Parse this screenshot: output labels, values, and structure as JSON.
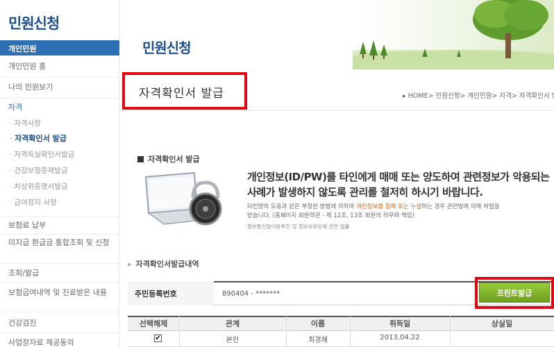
{
  "sidebar": {
    "title": "민원신청",
    "section": "개인민원",
    "items": [
      {
        "label": "개인민원 홈"
      },
      {
        "label": "나의 민원보기"
      },
      {
        "label": "자격"
      }
    ],
    "sub_items": [
      {
        "label": "자격사항",
        "active": false
      },
      {
        "label": "자격확인서 발급",
        "active": true
      },
      {
        "label": "자격득실확인서발급",
        "active": false
      },
      {
        "label": "건강보험증재발급",
        "active": false
      },
      {
        "label": "차상위증명서발급",
        "active": false
      },
      {
        "label": "급여정지 사항",
        "active": false
      }
    ],
    "lower_items": [
      {
        "label": "보험료 납부"
      },
      {
        "label": "미지급 환급금 통합조회 및 신청"
      },
      {
        "label": "조회/발급"
      },
      {
        "label": "보험급여내역 및 진료받은 내용"
      },
      {
        "label": "건강검진"
      },
      {
        "label": "사업장자료 제공동의"
      }
    ]
  },
  "header": {
    "heading": "민원신청"
  },
  "main": {
    "title": "자격확인서 발급",
    "breadcrumb": "▸ HOME> 민원신청> 개인민원> 자격> 자격확인서 발급",
    "section_label": "자격확인서 발급",
    "notice_big_1": "개인정보(ID/PW)를 타인에게 매매 또는 양도하여 관련정보가 악용되는",
    "notice_big_2": "사례가 발생하지 않도록 관리를 철저히 하시기 바랍니다.",
    "notice_small_1a": "타인명의 도용과 같은 부정한 방법에 의하여 ",
    "notice_small_1b": "개인정보를 침해 또는 누설",
    "notice_small_1c": "하는 경우 관련법에 의해 처벌을",
    "notice_small_2": "받습니다. (홈페이지 회원약관 - 제 12조, 13조 회원의 의무와 책임)",
    "notice_law": "정보통신망이용촉진 및 정보보호등에 관한 법률",
    "list_label": "자격확인서발급내역"
  },
  "form": {
    "id_label": "주민등록번호",
    "id_value": "890404 - *******",
    "print_button": "프린트발급"
  },
  "table": {
    "headers": [
      "선택해제",
      "관계",
      "이름",
      "취득일",
      "상실일"
    ],
    "rows": [
      {
        "checked": true,
        "check_mark": "✔",
        "relation": "본인",
        "name": "최경재",
        "acquired": "2013.04.22",
        "lost": ""
      }
    ]
  },
  "colors": {
    "brand_blue": "#1d4e8a",
    "section_blue": "#2d6fb5",
    "highlight_red": "#e30613",
    "button_green": "#7fb22a",
    "notice_orange": "#d3641c"
  }
}
